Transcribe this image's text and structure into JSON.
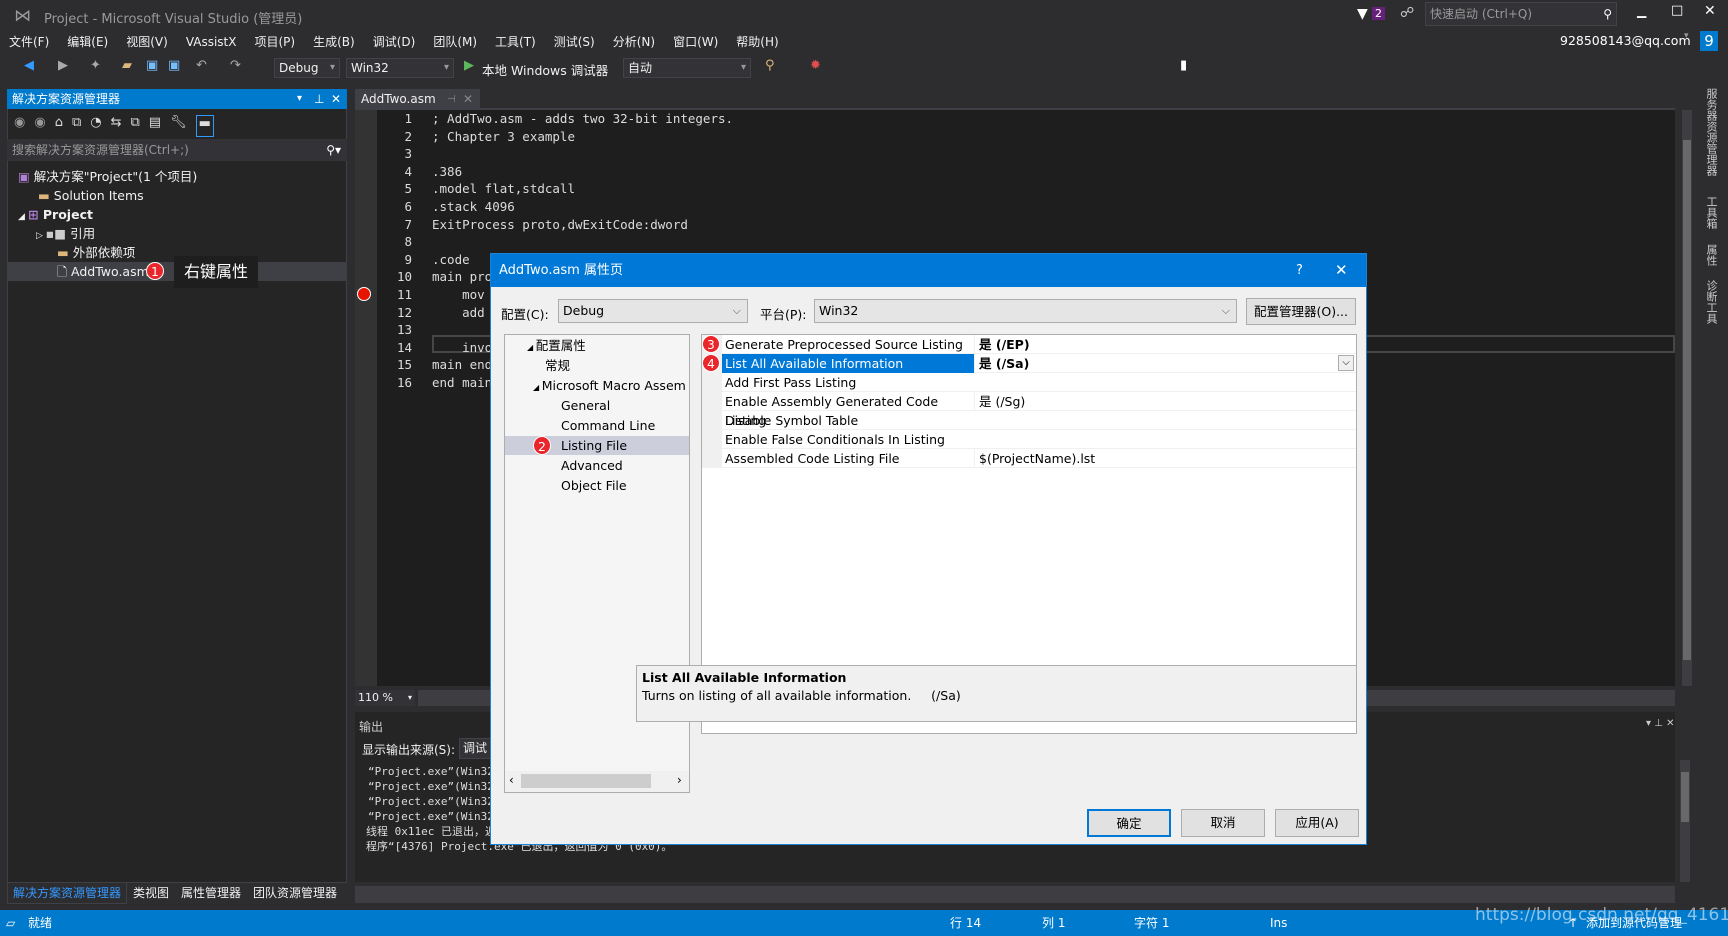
{
  "window": {
    "title": "Project - Microsoft Visual Studio (管理员)",
    "notifications": "2",
    "quick_launch_placeholder": "快速启动 (Ctrl+Q)",
    "account": "928508143@qq.com",
    "avatar_letter": "9"
  },
  "menu": [
    "文件(F)",
    "编辑(E)",
    "视图(V)",
    "VAssistX",
    "项目(P)",
    "生成(B)",
    "调试(D)",
    "团队(M)",
    "工具(T)",
    "测试(S)",
    "分析(N)",
    "窗口(W)",
    "帮助(H)"
  ],
  "toolbar": {
    "configuration": "Debug",
    "platform": "Win32",
    "debugger": "本地 Windows 调试器",
    "mode": "自动"
  },
  "solution_explorer": {
    "title": "解决方案资源管理器",
    "search_placeholder": "搜索解决方案资源管理器(Ctrl+;)",
    "items": [
      {
        "label": "解决方案\"Project\"(1 个项目)"
      },
      {
        "label": "Solution Items"
      },
      {
        "label": "Project"
      },
      {
        "label": "引用"
      },
      {
        "label": "外部依赖项"
      },
      {
        "label": "AddTwo.asm"
      }
    ],
    "annotation": {
      "number": "1",
      "text": "右键属性"
    },
    "bottom_tabs": [
      "解决方案资源管理器",
      "类视图",
      "属性管理器",
      "团队资源管理器"
    ]
  },
  "editor": {
    "tab": "AddTwo.asm",
    "zoom": "110 %",
    "lines": [
      {
        "n": "1",
        "t": "; AddTwo.asm - adds two 32-bit integers."
      },
      {
        "n": "2",
        "t": "; Chapter 3 example"
      },
      {
        "n": "3",
        "t": ""
      },
      {
        "n": "4",
        "t": ".386"
      },
      {
        "n": "5",
        "t": ".model flat,stdcall"
      },
      {
        "n": "6",
        "t": ".stack 4096"
      },
      {
        "n": "7",
        "t": "ExitProcess proto,dwExitCode:dword"
      },
      {
        "n": "8",
        "t": ""
      },
      {
        "n": "9",
        "t": ".code"
      },
      {
        "n": "10",
        "t": "main pro"
      },
      {
        "n": "11",
        "t": "    mov"
      },
      {
        "n": "12",
        "t": "    add"
      },
      {
        "n": "13",
        "t": ""
      },
      {
        "n": "14",
        "t": "    invo"
      },
      {
        "n": "15",
        "t": "main end"
      },
      {
        "n": "16",
        "t": "end main"
      }
    ]
  },
  "output": {
    "title": "输出",
    "source_label": "显示输出来源(S):",
    "source_value": "调试",
    "lines": [
      "“Project.exe”(Win32",
      "“Project.exe”(Win32",
      "“Project.exe”(Win32",
      "“Project.exe”(Win32",
      "线程 0x11ec 已退出，返",
      "程序“[4376] Project.exe”已退出，返回值为 0 (0x0)。"
    ]
  },
  "right_tabs": [
    "服务器资源管理器",
    "工具箱",
    "属性",
    "诊断工具"
  ],
  "status": {
    "ready": "就绪",
    "line": "行 14",
    "col": "列 1",
    "char": "字符 1",
    "mode": "Ins",
    "source_control": "添加到源代码管理",
    "watermark": "https://blog.csdn.net/qq_41610493"
  },
  "dialog": {
    "title": "AddTwo.asm 属性页",
    "help": "?",
    "config_label": "配置(C):",
    "config_value": "Debug",
    "platform_label": "平台(P):",
    "platform_value": "Win32",
    "config_manager": "配置管理器(O)...",
    "tree": [
      {
        "label": "配置属性"
      },
      {
        "label": "常规"
      },
      {
        "label": "Microsoft Macro Assem"
      },
      {
        "label": "General"
      },
      {
        "label": "Command Line"
      },
      {
        "label": "Listing File",
        "selected": true,
        "badge": "2"
      },
      {
        "label": "Advanced"
      },
      {
        "label": "Object File"
      }
    ],
    "properties": [
      {
        "name": "Generate Preprocessed Source Listing",
        "value": "是 (/EP)",
        "bold": true,
        "badge": "3"
      },
      {
        "name": "List All Available Information",
        "value": "是 (/Sa)",
        "bold": true,
        "selected": true,
        "badge": "4"
      },
      {
        "name": "Add First Pass Listing",
        "value": ""
      },
      {
        "name": "Enable Assembly Generated Code Listing",
        "value": "是 (/Sg)"
      },
      {
        "name": "Disable Symbol Table",
        "value": ""
      },
      {
        "name": "Enable False Conditionals In Listing",
        "value": ""
      },
      {
        "name": "Assembled Code Listing File",
        "value": "$(ProjectName).lst"
      }
    ],
    "description_title": "List All Available Information",
    "description_text": "Turns on listing of all available information.     (/Sa)",
    "ok": "确定",
    "cancel": "取消",
    "apply": "应用(A)"
  },
  "colors": {
    "accent": "#007acc",
    "dialog_accent": "#0078d7",
    "badge": "#e8262b",
    "breakpoint": "#e51400"
  }
}
